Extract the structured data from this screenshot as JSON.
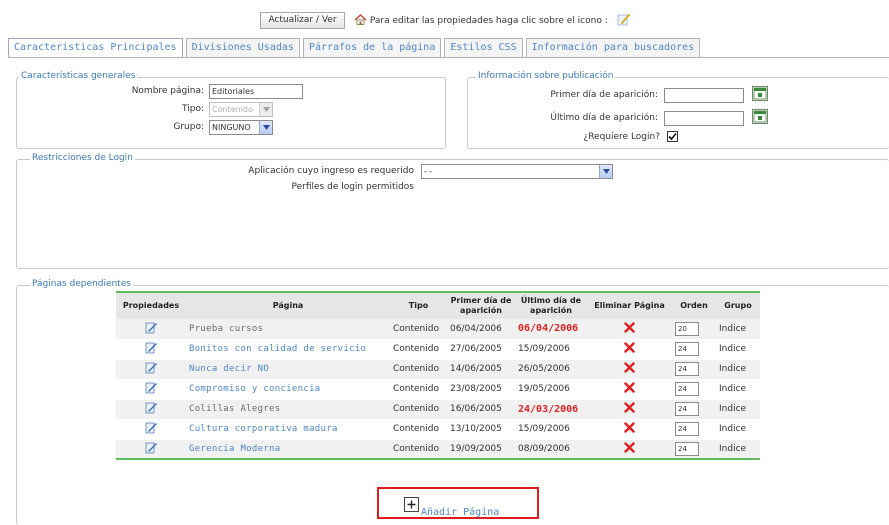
{
  "toolbar": {
    "refresh_label": "Actualizar / Ver",
    "hint_text": "Para editar las propiedades haga clic sobre el icono :"
  },
  "tabs": [
    {
      "label": "Caracteristicas Principales",
      "active": true
    },
    {
      "label": "Divisiones Usadas",
      "active": false
    },
    {
      "label": "Párrafos de la página",
      "active": false
    },
    {
      "label": "Estilos CSS",
      "active": false
    },
    {
      "label": "Información para buscadores",
      "active": false
    }
  ],
  "general": {
    "legend": "Características generales",
    "name_label": "Nombre página:",
    "name_value": "Editoriales",
    "type_label": "Tipo:",
    "type_value": "Contenido",
    "group_label": "Grupo:",
    "group_value": "NINGUNO"
  },
  "publication": {
    "legend": "Información sobre publicación",
    "first_day_label": "Primer día de aparición:",
    "first_day_value": "",
    "last_day_label": "Último día de aparición:",
    "last_day_value": "",
    "login_label": "¿Requiere Login?",
    "login_checked": true
  },
  "login": {
    "legend": "Restricciones de Login",
    "app_label": "Aplicación cuyo ingreso es requerido",
    "app_value": "- -",
    "profiles_label": "Perfiles de login permitidos"
  },
  "dependents": {
    "legend": "Páginas dependientes",
    "headers": {
      "props": "Propiedades",
      "page": "Página",
      "type": "Tipo",
      "first": "Primer día de aparición",
      "last": "Último día de aparición",
      "delete": "Eliminar Página",
      "order": "Orden",
      "group": "Grupo"
    },
    "rows": [
      {
        "page": "Prueba cursos",
        "type": "Contenido",
        "first": "06/04/2006",
        "last": "06/04/2006",
        "order": "20",
        "group": "Indice"
      },
      {
        "page": "Bonitos con calidad de servicio",
        "type": "Contenido",
        "first": "27/06/2005",
        "last": "15/09/2006",
        "order": "24",
        "group": "Indice"
      },
      {
        "page": "Nunca decir NO",
        "type": "Contenido",
        "first": "14/06/2005",
        "last": "26/05/2006",
        "order": "24",
        "group": "Indice"
      },
      {
        "page": "Compromiso y conciencia",
        "type": "Contenido",
        "first": "23/08/2005",
        "last": "19/05/2006",
        "order": "24",
        "group": "Indice"
      },
      {
        "page": "Colillas Alegres",
        "type": "Contenido",
        "first": "16/06/2005",
        "last": "24/03/2006",
        "order": "24",
        "group": "Indice"
      },
      {
        "page": "Cultura corporativa madura",
        "type": "Contenido",
        "first": "13/10/2005",
        "last": "15/09/2006",
        "order": "24",
        "group": "Indice"
      },
      {
        "page": "Gerencia Moderna",
        "type": "Contenido",
        "first": "19/09/2005",
        "last": "08/09/2006",
        "order": "24",
        "group": "Indice"
      }
    ],
    "add_label": "Añadir Página"
  },
  "colors": {
    "link": "#4f86c4",
    "alert_date": "#e02020",
    "table_rule": "#5cbf5c",
    "highlight_box": "#e01b1b"
  }
}
